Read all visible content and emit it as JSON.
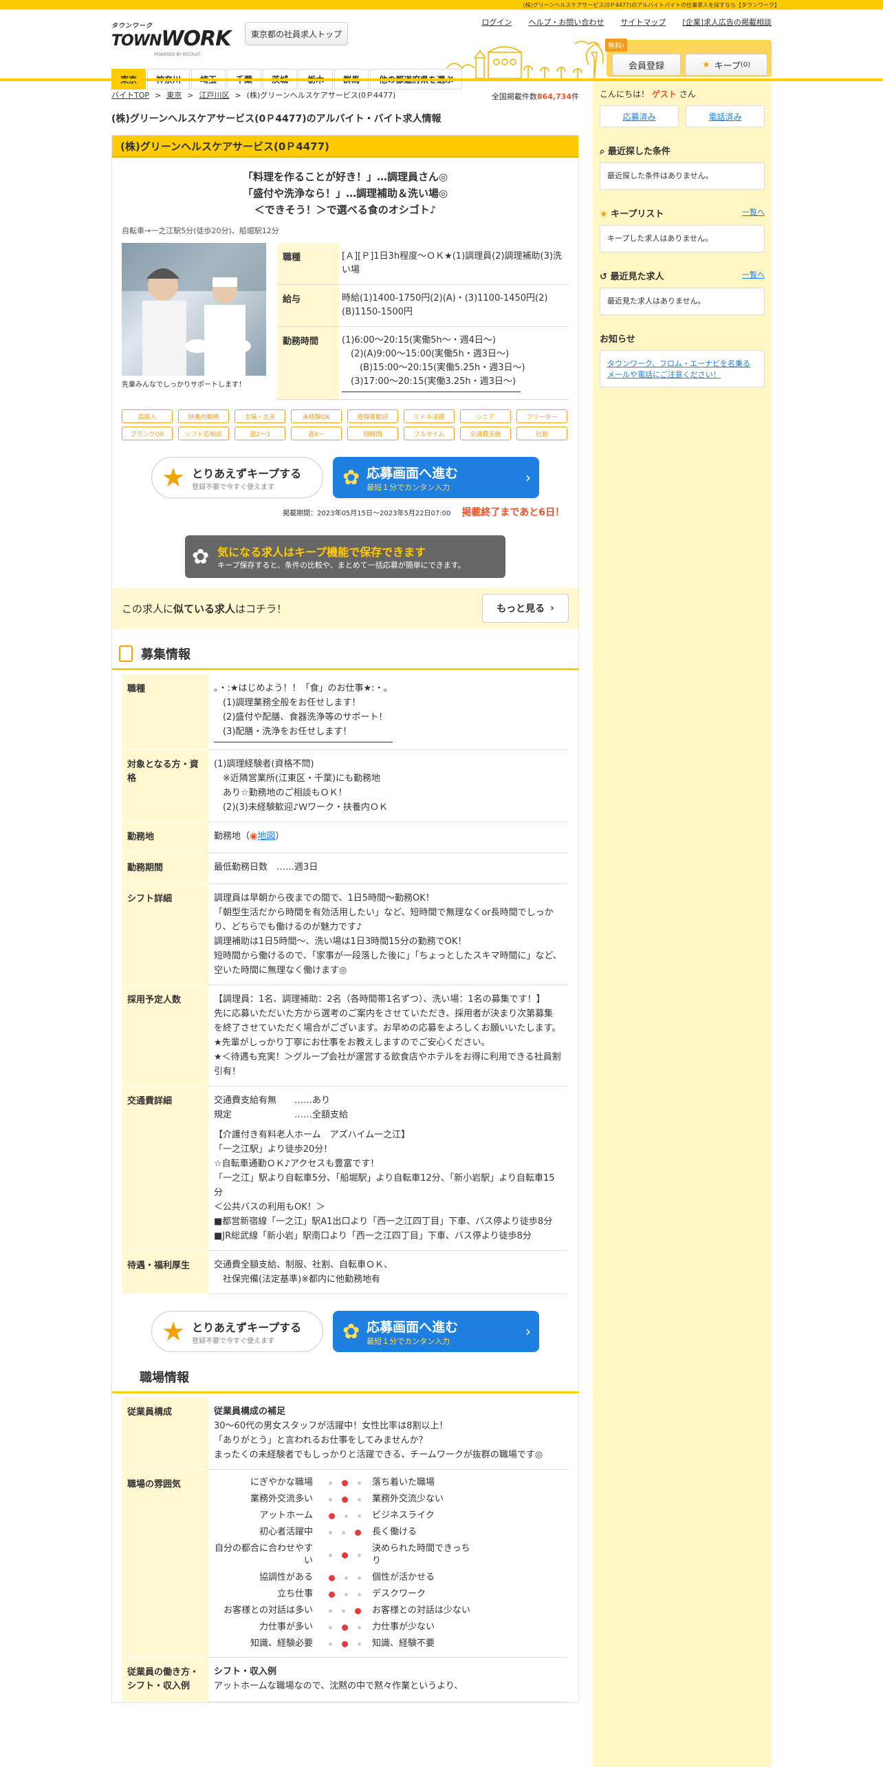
{
  "top_strip": "(株)グリーンヘルスケアサービス(0Ｐ4477)のアルバイトパイトの仕事求人を探すなら【タウンワーク】",
  "header": {
    "logo_line1": "タウンワーク",
    "logo_line2": "TOWN",
    "logo_line3": "WORK",
    "logo_sub": "POWERED BY RECRUIT",
    "area_button": "東京都の社員求人トップ",
    "links": [
      "ログイン",
      "ヘルプ・お問い合わせ",
      "サイトマップ",
      "[企業]求人広告の掲載相談"
    ],
    "free_badge": "無料!",
    "member_button": "会員登録",
    "keep_button": "キープ",
    "keep_count": "(0)"
  },
  "nav": [
    "東京",
    "神奈川",
    "埼玉",
    "千葉",
    "茨城",
    "栃木",
    "群馬",
    "他の都道府県を選ぶ"
  ],
  "breadcrumb": [
    "バイトTOP",
    "東京",
    "江戸川区",
    "(株)グリーンヘルスケアサービス(0Ｐ4477)"
  ],
  "total_label": "全国掲載件数",
  "total_count": "864,734",
  "total_unit": "件",
  "page_title": "(株)グリーンヘルスケアサービス(0Ｐ4477)のアルバイト・バイト求人情報",
  "job": {
    "company": "(株)グリーンヘルスケアサービス(0Ｐ4477)",
    "catch": [
      "「料理を作ることが好き！」…調理員さん◎",
      "「盛付や洗浄なら！」…調理補助＆洗い場◎",
      "＜できそう！＞で選べる食のオシゴト♪"
    ],
    "access": "自転車→一之江駅5分(徒歩20分)、船堀駅12分",
    "photo_caption": "先輩みんなでしっかりサポートします！",
    "spec": [
      {
        "k": "職種",
        "v": "[Ａ][Ｐ]1日3h程度～ＯＫ★(1)調理員(2)調理補助(3)洗い場"
      },
      {
        "k": "給与",
        "v": "時給(1)1400-1750円(2)(A)・(3)1100-1450円(2)(B)1150-1500円"
      },
      {
        "k": "勤務時間",
        "v": "(1)6:00～20:15(実働5h～・週4日～)\n　(2)(A)9:00～15:00(実働5h・週3日～)\n　　(B)15:00～20:15(実働5.25h・週3日～)\n　(3)17:00～20:15(実働3.25h・週3日～)"
      }
    ],
    "tags": [
      "高収入",
      "扶養内勤務",
      "主婦・主夫",
      "未経験OK",
      "経験者歓迎",
      "ミドル活躍",
      "シニア",
      "フリーター",
      "ブランクOK",
      "シフト応相談",
      "週2～3",
      "週4～",
      "短時間",
      "フルタイム",
      "交通費支給",
      "社割"
    ],
    "keep_title": "とりあえずキープする",
    "keep_sub": "登録不要で今すぐ使えます",
    "apply_title": "応募画面へ進む",
    "apply_sub": "最短１分でカンタン入力",
    "period": "掲載期間：2023年05月15日～2023年5月22日07:00",
    "remain": "掲載終了まであと6日！",
    "keepinfo_title": "気になる求人はキープ機能で保存できます",
    "keepinfo_sub": "キープ保存すると、条件の比較や、まとめて一括応募が簡単にできます。",
    "similar_a": "この求人に",
    "similar_b": "似ている求人",
    "similar_c": "はコチラ！",
    "more": "もっと見る"
  },
  "recruit": {
    "title": "募集情報",
    "rows": [
      {
        "k": "職種",
        "v": "。・:★はじめよう！！「食」のお仕事★:・。\n　(1)調理業務全般をお任せします！\n　(2)盛付や配膳、食器洗浄等のサポート！\n　(3)配膳・洗浄をお任せします！"
      },
      {
        "k": "対象となる方・資格",
        "v": "(1)調理経験者(資格不問)\n　※近隣営業所(江東区・千葉)にも勤務地\n　あり☆勤務地のご相談もＯＫ！\n　(2)(3)未経験歓迎♪Ｗワーク・扶養内ＯＫ"
      },
      {
        "k": "勤務地",
        "v": "勤務地",
        "map": "地図"
      },
      {
        "k": "勤務期間",
        "v": "最低勤務日数　……週3日"
      },
      {
        "k": "シフト詳細",
        "v": "調理員は早朝から夜までの間で、1日5時間～勤務OK！\n「朝型生活だから時間を有効活用したい」など、短時間で無理なくor長時間でしっかり、どちらでも働けるのが魅力です♪\n調理補助は1日5時間～、洗い場は1日3時間15分の勤務でOK！\n短時間から働けるので、「家事が一段落した後に」「ちょっとしたスキマ時間に」など、\n空いた時間に無理なく働けます◎"
      },
      {
        "k": "採用予定人数",
        "v": "【調理員：1名、調理補助：2名（各時間帯1名ずつ）、洗い場：1名の募集です！】\n先に応募いただいた方から選考のご案内をさせていただき、採用者が決まり次第募集を終了させていただく場合がございます。お早めの応募をよろしくお願いいたします。\n★先輩がしっかり丁寧にお仕事をお教えしますのでご安心ください。\n★＜待遇も充実！＞グループ会社が運営する飲食店やホテルをお得に利用できる社員割引有！"
      },
      {
        "k": "交通費詳細",
        "v": "交通費支給有無　　……あり\n規定　　　　　　　……全額支給",
        "v2": "【介護付き有料老人ホーム　アズハイム一之江】\n「一之江駅」より徒歩20分！\n☆自転車通勤ＯＫ♪アクセスも豊富です！\n「一之江」駅より自転車5分、「船堀駅」より自転車12分、「新小岩駅」より自転車15分\n＜公共バスの利用もOK！＞\n■都営新宿線「一之江」駅A1出口より「西一之江四丁目」下車、バス停より徒歩8分\n■JR総武線「新小岩」駅南口より「西一之江四丁目」下車、バス停より徒歩8分"
      },
      {
        "k": "待遇・福利厚生",
        "v": "交通費全額支給、制服、社割、自転車ＯＫ、\n　社保完備(法定基準)※都内に他勤務地有"
      }
    ]
  },
  "workplace": {
    "title": "職場情報",
    "staff_k": "従業員構成",
    "staff_title": "従業員構成の補足",
    "staff_v": "30～60代の男女スタッフが活躍中！女性比率は8割以上！\n「ありがとう」と言われるお仕事をしてみませんか？\nまったくの未経験者でもしっかりと活躍できる、チームワークが抜群の職場です◎",
    "mood_k": "職場の雰囲気",
    "mood": [
      {
        "l": "にぎやかな職場",
        "r": "落ち着いた職場",
        "pos": 2
      },
      {
        "l": "業務外交流多い",
        "r": "業務外交流少ない",
        "pos": 2
      },
      {
        "l": "アットホーム",
        "r": "ビジネスライク",
        "pos": 1
      },
      {
        "l": "初心者活躍中",
        "r": "長く働ける",
        "pos": 3
      },
      {
        "l": "自分の都合に合わせやすい",
        "r": "決められた時間できっちり",
        "pos": 2
      },
      {
        "l": "協調性がある",
        "r": "個性が活かせる",
        "pos": 1
      },
      {
        "l": "立ち仕事",
        "r": "デスクワーク",
        "pos": 1
      },
      {
        "l": "お客様との対話は多い",
        "r": "お客様との対話は少ない",
        "pos": 3
      },
      {
        "l": "力仕事が多い",
        "r": "力仕事が少ない",
        "pos": 2
      },
      {
        "l": "知識、経験必要",
        "r": "知識、経験不要",
        "pos": 2
      }
    ],
    "work_k": "従業員の働き方・シフト・収入例",
    "work_title": "シフト・収入例",
    "work_v": "アットホームな職場なので、沈黙の中で黙々作業というより、"
  },
  "side": {
    "hello_a": "こんにちは！",
    "guest": "ゲスト",
    "hello_b": "さん",
    "tab1": "応募済み",
    "tab2": "電話済み",
    "recent_cond": "最近探した条件",
    "recent_cond_empty": "最近探した条件はありません。",
    "keeplist": "キープリスト",
    "keeplist_link": "一覧へ",
    "keeplist_empty": "キープした求人はありません。",
    "recent_jobs": "最近見た求人",
    "recent_jobs_link": "一覧へ",
    "recent_jobs_empty": "最近見た求人はありません。",
    "notice": "お知らせ",
    "notice_link": "タウンワーク、フロム・エーナビを名乗るメールや電話にご注意ください！"
  }
}
